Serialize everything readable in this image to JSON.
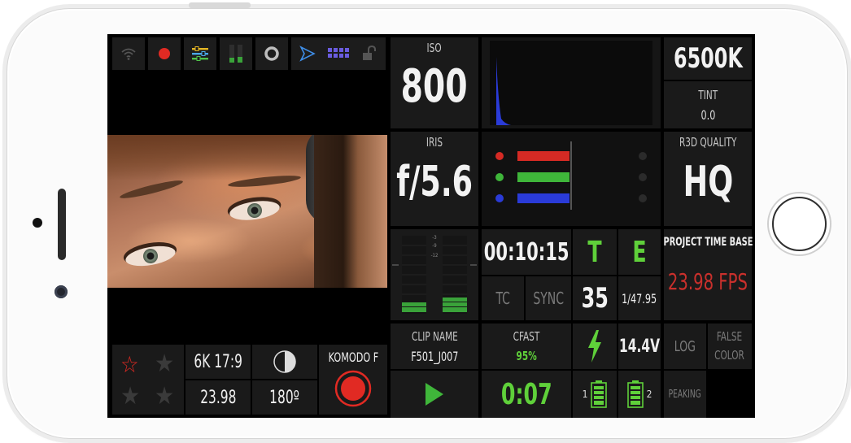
{
  "top_icons": [
    "wifi-icon",
    "record-dot-icon",
    "settings-sliders-icon",
    "audio-levels-icon",
    "focus-ring-icon",
    "play-triangle-icon",
    "keypad-grid-icon",
    "unlock-icon"
  ],
  "iso": {
    "label": "ISO",
    "value": "800"
  },
  "white_balance": {
    "value": "6500K"
  },
  "tint": {
    "label": "TINT",
    "value": "0.0"
  },
  "iris": {
    "label": "IRIS",
    "value": "f/5.6"
  },
  "r3d_quality": {
    "label": "R3D QUALITY",
    "value": "HQ"
  },
  "audio_meter": {
    "ticks": [
      "-3",
      "-9",
      "-12"
    ],
    "left_level": 0.18,
    "right_level": 0.2
  },
  "timecode": {
    "value": "00:10:15",
    "tc_label": "TC",
    "sync_label": "SYNC"
  },
  "t_indicator": "T",
  "e_indicator": "E",
  "frame_count": "35",
  "shutter_speed": "1/47.95",
  "project_time_base": {
    "label": "PROJECT TIME BASE",
    "value": "23.98 FPS"
  },
  "resolution": "6K 17:9",
  "fps": "23.98",
  "shutter_angle": "180º",
  "camera_name": "KOMODO F",
  "clip": {
    "label": "CLIP NAME",
    "value": "F501_J007"
  },
  "media": {
    "label": "CFAST",
    "value": "95%"
  },
  "voltage": "14.4V",
  "log_label": "LOG",
  "false_color_label": "FALSE\nCOLOR",
  "peaking_label": "PEAKING",
  "duration": "0:07",
  "battery": {
    "slot_1": "1",
    "slot_2": "2",
    "level_1": 0.85,
    "level_2": 0.85
  },
  "rating": {
    "filled": 1,
    "total": 4
  },
  "colors": {
    "accent_green": "#5fd03a",
    "accent_red": "#e12a23",
    "fps_red": "#c9302c",
    "bg": "#1a1a1a"
  }
}
